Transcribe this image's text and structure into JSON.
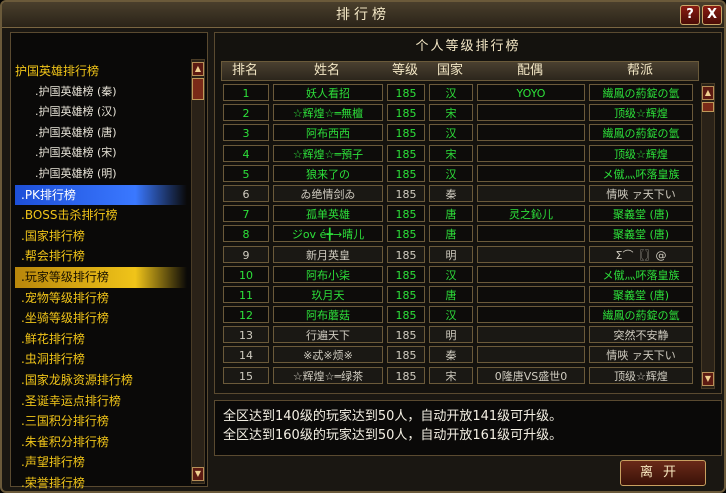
{
  "window": {
    "title": "排行榜",
    "help_label": "?",
    "close_label": "X"
  },
  "sidebar": {
    "items": [
      {
        "label": "护国英雄排行榜",
        "type": "top"
      },
      {
        "label": ".护国英雄榜 (秦)",
        "type": "sub"
      },
      {
        "label": ".护国英雄榜 (汉)",
        "type": "sub"
      },
      {
        "label": ".护国英雄榜 (唐)",
        "type": "sub"
      },
      {
        "label": ".护国英雄榜 (宋)",
        "type": "sub"
      },
      {
        "label": ".护国英雄榜 (明)",
        "type": "sub"
      },
      {
        "label": ".PK排行榜",
        "type": "sel-blue"
      },
      {
        "label": ".BOSS击杀排行榜",
        "type": "item"
      },
      {
        "label": ".国家排行榜",
        "type": "item"
      },
      {
        "label": ".帮会排行榜",
        "type": "item"
      },
      {
        "label": ".玩家等级排行榜",
        "type": "sel-gold"
      },
      {
        "label": ".宠物等级排行榜",
        "type": "item"
      },
      {
        "label": ".坐骑等级排行榜",
        "type": "item"
      },
      {
        "label": ".鲜花排行榜",
        "type": "item"
      },
      {
        "label": ".虫洞排行榜",
        "type": "item"
      },
      {
        "label": ".国家龙脉资源排行榜",
        "type": "item"
      },
      {
        "label": ".圣诞幸运点排行榜",
        "type": "item"
      },
      {
        "label": ".三国积分排行榜",
        "type": "item"
      },
      {
        "label": ".朱雀积分排行榜",
        "type": "item"
      },
      {
        "label": ".声望排行榜",
        "type": "item"
      },
      {
        "label": ".荣誉排行榜",
        "type": "item"
      }
    ]
  },
  "ranking": {
    "title": "个人等级排行榜",
    "columns": [
      "排名",
      "姓名",
      "等级",
      "国家",
      "配偶",
      "帮派"
    ],
    "rows": [
      {
        "rank": "1",
        "name": "妖人看招",
        "level": "185",
        "country": "汉",
        "spouse": "YOYO",
        "guild": "繊鳳の葯錠の氫",
        "hl": true
      },
      {
        "rank": "2",
        "name": "☆辉煌☆═無檀",
        "level": "185",
        "country": "宋",
        "spouse": "",
        "guild": "顶级☆辉煌",
        "hl": true
      },
      {
        "rank": "3",
        "name": "阿布西西",
        "level": "185",
        "country": "汉",
        "spouse": "",
        "guild": "繊鳳の葯錠の氫",
        "hl": true
      },
      {
        "rank": "4",
        "name": "☆辉煌☆═預子",
        "level": "185",
        "country": "宋",
        "spouse": "",
        "guild": "顶级☆辉煌",
        "hl": true
      },
      {
        "rank": "5",
        "name": "狼来了の",
        "level": "185",
        "country": "汉",
        "spouse": "",
        "guild": "メ僦灬吥落皇族",
        "hl": true
      },
      {
        "rank": "6",
        "name": "ゐ绝情剑ゐ",
        "level": "185",
        "country": "秦",
        "spouse": "",
        "guild": "情唊 ァ天下い",
        "hl": false
      },
      {
        "rank": "7",
        "name": "孤单英雄",
        "level": "185",
        "country": "唐",
        "spouse": "灵之鈊儿",
        "guild": "聚義堂 (唐)",
        "hl": true
      },
      {
        "rank": "8",
        "name": "ジov é╋→晴儿",
        "level": "185",
        "country": "唐",
        "spouse": "",
        "guild": "聚義堂 (唐)",
        "hl": true
      },
      {
        "rank": "9",
        "name": "新月英皇",
        "level": "185",
        "country": "明",
        "spouse": "",
        "guild": "Σ⌒〖〗@",
        "hl": false
      },
      {
        "rank": "10",
        "name": "阿布小柒",
        "level": "185",
        "country": "汉",
        "spouse": "",
        "guild": "メ僦灬吥落皇族",
        "hl": true
      },
      {
        "rank": "11",
        "name": "玖月天",
        "level": "185",
        "country": "唐",
        "spouse": "",
        "guild": "聚義堂 (唐)",
        "hl": true
      },
      {
        "rank": "12",
        "name": "阿布蘑菇",
        "level": "185",
        "country": "汉",
        "spouse": "",
        "guild": "繊鳳の葯錠の氫",
        "hl": true
      },
      {
        "rank": "13",
        "name": "行遍天下",
        "level": "185",
        "country": "明",
        "spouse": "",
        "guild": "突然不安静",
        "hl": false
      },
      {
        "rank": "14",
        "name": "※忒※烦※",
        "level": "185",
        "country": "秦",
        "spouse": "",
        "guild": "情唊 ァ天下い",
        "hl": false
      },
      {
        "rank": "15",
        "name": "☆辉煌☆═绿茶",
        "level": "185",
        "country": "宋",
        "spouse": "0隆唐VS盛世0",
        "guild": "顶级☆辉煌",
        "hl": false
      }
    ]
  },
  "notice": {
    "line1": "全区达到140级的玩家达到50人，自动开放141级可升级。",
    "line2": "全区达到160级的玩家达到50人，自动开放161级可升级。"
  },
  "leave_button": {
    "label": "离开"
  },
  "icons": {
    "scroll_up": "triangle-up-icon",
    "scroll_down": "triangle-down-icon"
  }
}
